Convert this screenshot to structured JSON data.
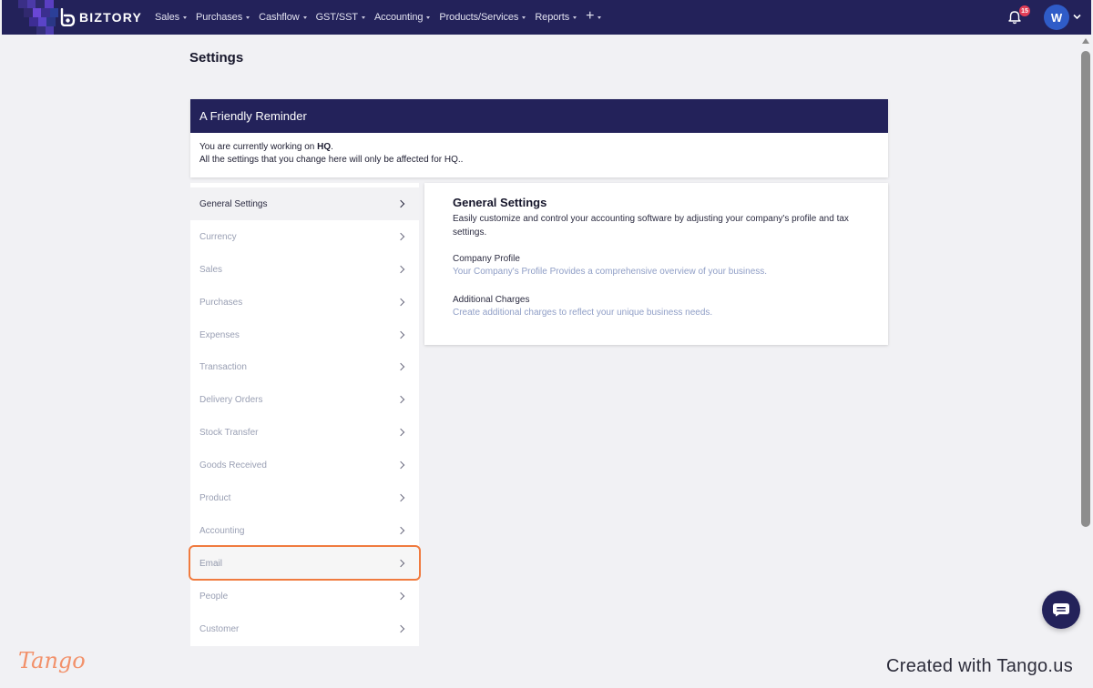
{
  "nav": {
    "brand": "BIZTORY",
    "items": [
      {
        "label": "Sales"
      },
      {
        "label": "Purchases"
      },
      {
        "label": "Cashflow"
      },
      {
        "label": "GST/SST"
      },
      {
        "label": "Accounting"
      },
      {
        "label": "Products/Services"
      },
      {
        "label": "Reports"
      }
    ],
    "add_icon": "plus-icon",
    "notification_count": "15",
    "avatar_initial": "W",
    "colors": {
      "bar": "#23225a",
      "badge": "#e23e57",
      "avatar": "#2f5cc8"
    }
  },
  "page": {
    "title": "Settings"
  },
  "reminder": {
    "title": "A Friendly Reminder",
    "line1_prefix": "You are currently working on ",
    "line1_bold": "HQ",
    "line1_suffix": ".",
    "line2": "All the settings that you change here will only be affected for HQ.."
  },
  "settings_menu": {
    "items": [
      {
        "label": "General Settings"
      },
      {
        "label": "Currency"
      },
      {
        "label": "Sales"
      },
      {
        "label": "Purchases"
      },
      {
        "label": "Expenses"
      },
      {
        "label": "Transaction"
      },
      {
        "label": "Delivery Orders"
      },
      {
        "label": "Stock Transfer"
      },
      {
        "label": "Goods Received"
      },
      {
        "label": "Product"
      },
      {
        "label": "Accounting"
      },
      {
        "label": "Email"
      },
      {
        "label": "People"
      },
      {
        "label": "Customer"
      }
    ],
    "active": "General Settings",
    "highlighted": "Email"
  },
  "detail": {
    "title": "General Settings",
    "description": "Easily customize and control your accounting software by adjusting your company's profile and tax settings.",
    "links": [
      {
        "label": "Company Profile",
        "description": "Your Company's Profile Provides a comprehensive overview of your business."
      },
      {
        "label": "Additional Charges",
        "description": "Create additional charges to reflect your unique business needs."
      }
    ]
  },
  "footer": {
    "logo": "Tango",
    "text": "Created with Tango.us",
    "logo_color": "#f2916a"
  },
  "highlight_color": "#f07b3f"
}
